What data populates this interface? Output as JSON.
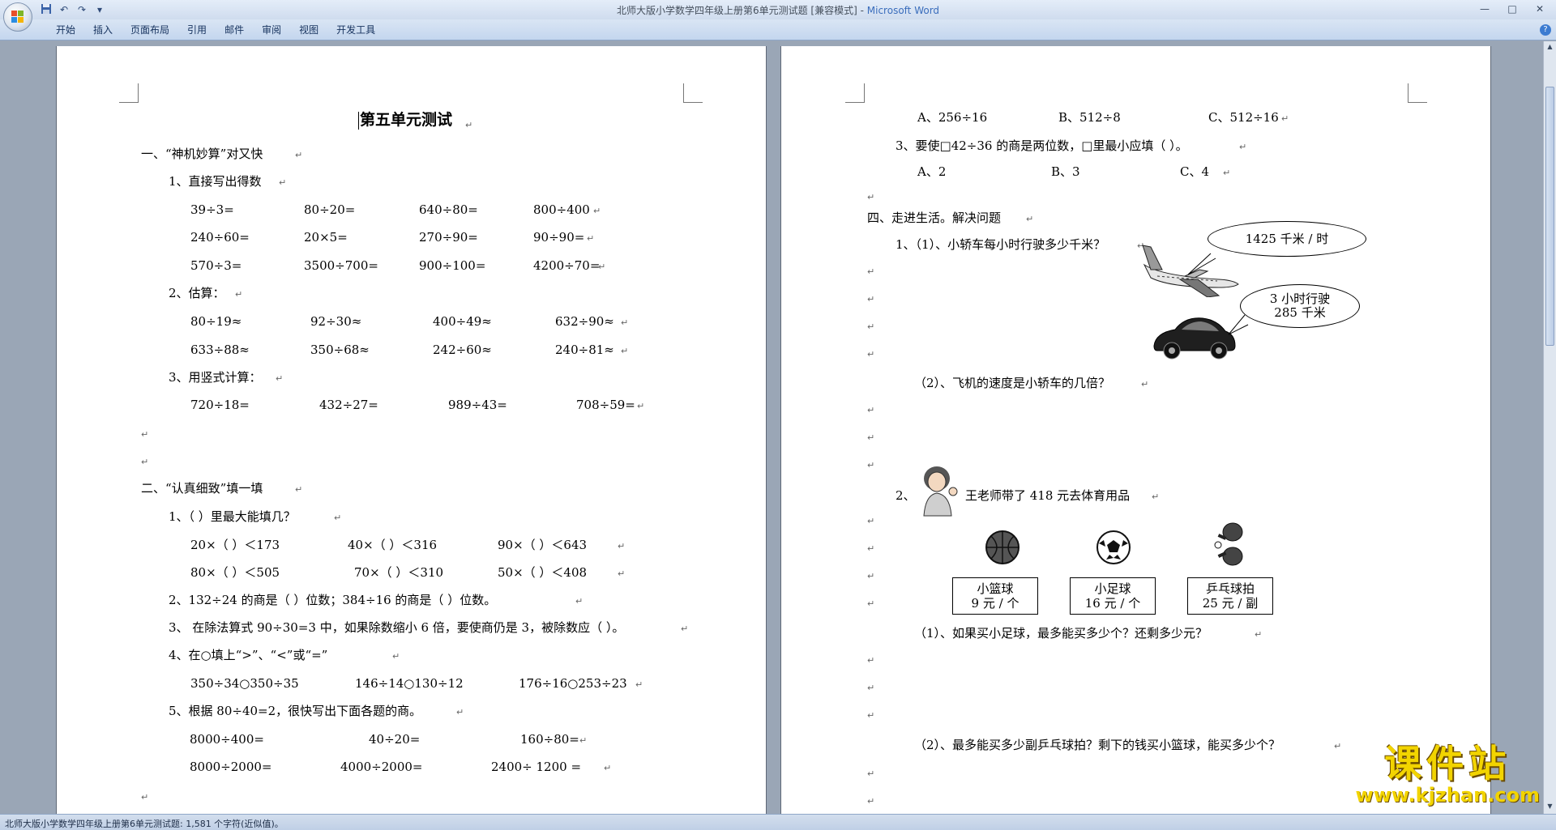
{
  "window": {
    "title": "北师大版小学数学四年级上册第6单元测试题 [兼容模式]",
    "app_name": "Microsoft Word"
  },
  "qat": {
    "save_icon": "save-icon",
    "undo_icon": "undo-icon",
    "redo_icon": "redo-icon",
    "more": "▾"
  },
  "ribbon": {
    "tabs": [
      "开始",
      "插入",
      "页面布局",
      "引用",
      "邮件",
      "审阅",
      "视图",
      "开发工具"
    ]
  },
  "mark": "↵",
  "left_page": {
    "title": "第五单元测试",
    "sec1": "一、“神机妙算”对又快",
    "q1": "1、直接写出得数",
    "q1_rows": [
      [
        "39÷3=",
        "80÷20=",
        "640÷80=",
        "800÷400"
      ],
      [
        "240÷60=",
        "20×5=",
        "270÷90=",
        "90÷90="
      ],
      [
        "570÷3=",
        "3500÷700=",
        "900÷100=",
        "4200÷70="
      ]
    ],
    "q2": "2、估算：",
    "q2_rows": [
      [
        "80÷19≈",
        "92÷30≈",
        "400÷49≈",
        "632÷90≈"
      ],
      [
        "633÷88≈",
        "350÷68≈",
        "242÷60≈",
        "240÷81≈"
      ]
    ],
    "q3": "3、用竖式计算：",
    "q3_row": [
      "720÷18=",
      "432÷27=",
      "989÷43=",
      "708÷59="
    ],
    "sec2": "二、“认真细致”填一填",
    "s2q1": "1、（    ）里最大能填几？",
    "s2q1_rows": [
      [
        "20×（    ）＜173",
        "40×（    ）＜316",
        "90×（    ）＜643"
      ],
      [
        "80×（    ）＜505",
        "70×（    ）＜310",
        "50×（    ）＜408"
      ]
    ],
    "s2q2": "2、132÷24 的商是（    ）位数；384÷16 的商是（    ）位数。",
    "s2q3": "3、 在除法算式 90÷30=3 中，如果除数缩小 6 倍，要使商仍是 3，被除数应（          ）。",
    "s2q4": "4、在○填上“>”、“<”或“=”",
    "s2q4_row": [
      "350÷34○350÷35",
      "146÷14○130÷12",
      "176÷16○253÷23"
    ],
    "s2q5": "5、根据 80÷40=2，很快写出下面各题的商。",
    "s2q5_rows": [
      [
        "8000÷400=",
        "40÷20=",
        "160÷80="
      ],
      [
        "8000÷2000=",
        "4000÷2000=",
        "2400÷  1200 ="
      ]
    ]
  },
  "right_page": {
    "opts_a": [
      "A、256÷16",
      "B、512÷8",
      "C、512÷16"
    ],
    "q3": "3、要使□42÷36 的商是两位数，□里最小应填（    ）。",
    "opts_b": [
      "A、2",
      "B、3",
      "C、4"
    ],
    "sec4": "四、走进生活。解决问题",
    "p1a": "1、（1）、小轿车每小时行驶多少千米？",
    "bubble1": "1425 千米 / 时",
    "bubble2_l1": "3 小时行驶",
    "bubble2_l2": "285 千米",
    "p1b": "（2）、飞机的速度是小轿车的几倍？",
    "p2_num": "2、",
    "p2": "王老师带了 418 元去体育用品",
    "items": [
      {
        "name": "小篮球",
        "price": "9 元 / 个"
      },
      {
        "name": "小足球",
        "price": "16 元 / 个"
      },
      {
        "name": "乒乓球拍",
        "price": "25 元 / 副"
      }
    ],
    "p2a": "（1）、如果买小足球，最多能买多少个？还剩多少元？",
    "p2b": "（2）、最多能买多少副乒乓球拍？剩下的钱买小篮球，能买多少个？"
  },
  "status": {
    "text": "北师大版小学数学四年级上册第6单元测试题: 1,581 个字符(近似值)。"
  },
  "watermark": {
    "title": "课件站",
    "url": "www.kjzhan.com"
  }
}
